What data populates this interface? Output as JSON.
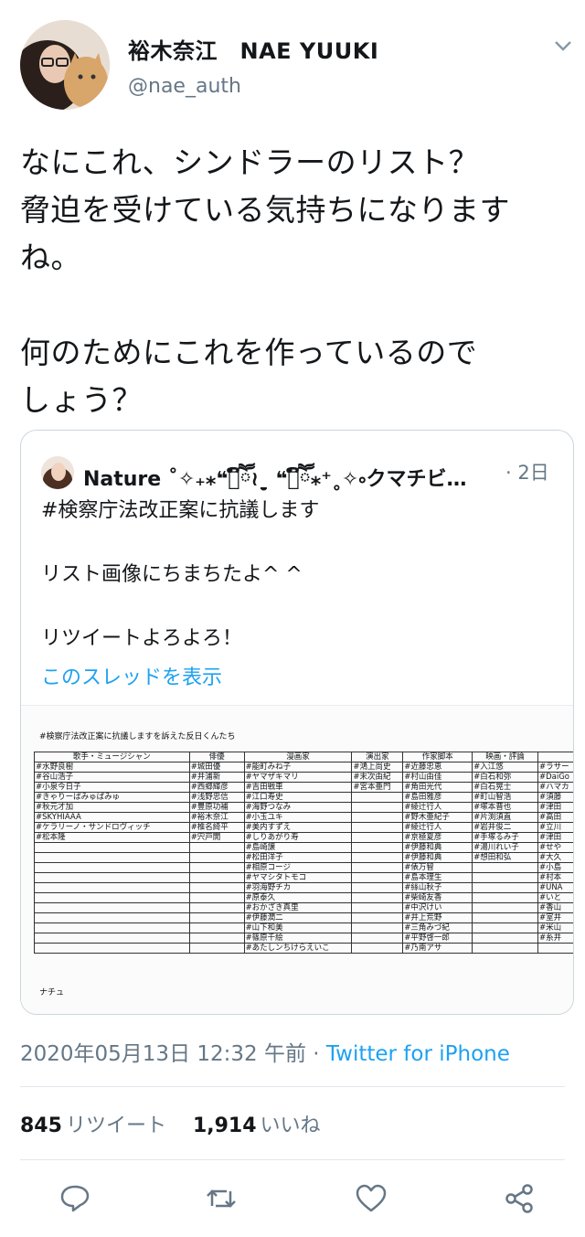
{
  "author": {
    "display_name": "裕木奈江　NAE YUUKI",
    "handle": "@nae_auth"
  },
  "tweet": {
    "text": "なにこれ、シンドラーのリスト？\n脅迫を受けている気持ちになります\nね。\n\n何のためにこれを作っているので\nしょう？",
    "timestamp": "2020年05月13日 12:32 午前 · ",
    "source": "Twitter for iPhone",
    "retweets_count": "845",
    "retweets_label": "リツイート",
    "likes_count": "1,914",
    "likes_label": "いいね"
  },
  "quoted": {
    "display_name": "Nature ˚✧₊⁎❝᷀ົཽ≀ˍ̮ ❝᷀ົཽ⁎⁺˳✧༚クマチビ食堂 ...",
    "time": "· 2日",
    "text": "#検察庁法改正案に抗議します\n\nリスト画像にちまちたよ^ ^\n\nリツイートよろよろ！",
    "thread_link": "このスレッドを表示",
    "image": {
      "title": "#検察庁法改正案に抗議しますを訴えた反日くんたち",
      "signature": "ナチュ",
      "columns": [
        "歌手・ミュージシャン",
        "俳優",
        "漫画家",
        "演出家",
        "作家脚本",
        "映画・評論",
        ""
      ],
      "rows": [
        [
          "#水野良樹",
          "#城田優",
          "#能町みね子",
          "#鴻上尚史",
          "#近藤忠恵",
          "#入江悠",
          "#ラサー"
        ],
        [
          "#谷山浩子",
          "#井浦新",
          "#ヤマザキマリ",
          "#末次由紀",
          "#村山由佳",
          "#白石和弥",
          "#DaiGo"
        ],
        [
          "#小泉今日子",
          "#西郷輝彦",
          "#吉田戦車",
          "#宮本亜門",
          "#角田光代",
          "#白石晃士",
          "#ハマカ"
        ],
        [
          "#きゃりーぱみゅぱみゅ",
          "#浅野忠信",
          "#江口寿史",
          "",
          "#島田雅彦",
          "#町山智浩",
          "#須藤"
        ],
        [
          "#秋元才加",
          "#豊原功補",
          "#海野つなみ",
          "",
          "#綾辻行人",
          "#塚本晋也",
          "#津田"
        ],
        [
          "#SKYHIAAA",
          "#裕木奈江",
          "#小玉ユキ",
          "",
          "#野木亜紀子",
          "#片渕須直",
          "#高田"
        ],
        [
          "#ケラリーノ・サンドロヴィッチ",
          "#椎名綺平",
          "#美内すずえ",
          "",
          "#綾辻行人",
          "#岩井俊二",
          "#立川"
        ],
        [
          "#松本隆",
          "#宍戸開",
          "#しりあがり寿",
          "",
          "#京極夏彦",
          "#手塚るみ子",
          "#津田"
        ],
        [
          "",
          "",
          "#島崎譲",
          "",
          "#伊藤和典",
          "#湯川れい子",
          "#せや"
        ],
        [
          "",
          "",
          "#松田洋子",
          "",
          "#伊藤和典",
          "#想田和弘",
          "#大久"
        ],
        [
          "",
          "",
          "#相原コージ",
          "",
          "#俵万智",
          "",
          "#小島"
        ],
        [
          "",
          "",
          "#ヤマシタトモコ",
          "",
          "#島本理生",
          "",
          "#村本"
        ],
        [
          "",
          "",
          "#羽海野チカ",
          "",
          "#絲山秋子",
          "",
          "#UNA"
        ],
        [
          "",
          "",
          "#原泰久",
          "",
          "#柴崎友香",
          "",
          "#いと"
        ],
        [
          "",
          "",
          "#おかざき真里",
          "",
          "#中沢けい",
          "",
          "#香山"
        ],
        [
          "",
          "",
          "#伊藤潤二",
          "",
          "#井上荒野",
          "",
          "#室井"
        ],
        [
          "",
          "",
          "#山下和美",
          "",
          "#三角みづ紀",
          "",
          "#米山"
        ],
        [
          "",
          "",
          "#篠原千絵",
          "",
          "#平野啓一郎",
          "",
          "#糸井"
        ],
        [
          "",
          "",
          "#あたしンちけらえいこ",
          "",
          "#乃南アサ",
          "",
          ""
        ]
      ]
    }
  },
  "actions": [
    "reply-icon",
    "retweet-icon",
    "like-icon",
    "share-icon"
  ],
  "colors": {
    "accent": "#1da1f2",
    "muted": "#657786",
    "border": "#ccd6dd"
  }
}
